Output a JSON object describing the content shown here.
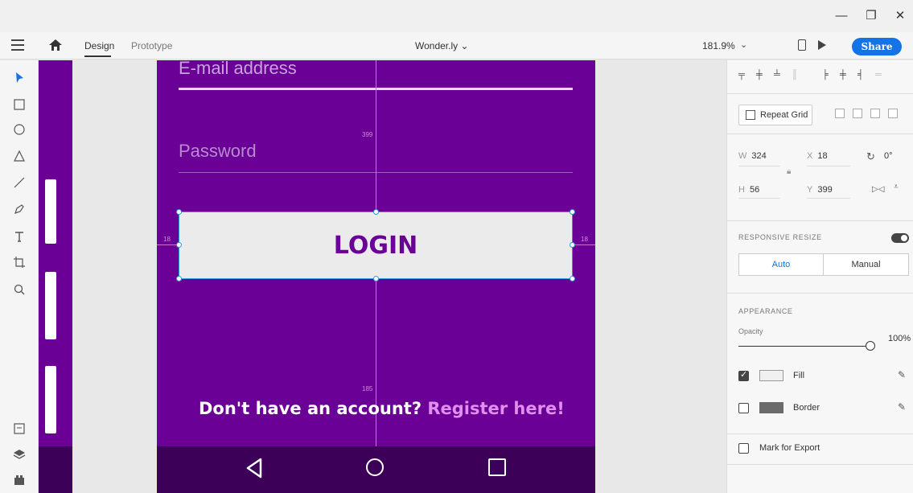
{
  "window": {
    "minimize": "—",
    "restore": "❐",
    "close": "✕"
  },
  "menubar": {
    "tab_design": "Design",
    "tab_prototype": "Prototype",
    "document_title": "Wonder.ly ⌄",
    "zoom": "181.9%",
    "zoom_chevron": "⌄",
    "share_label": "Share",
    "accent_color": "#1473e6"
  },
  "tools": [
    "select-tool",
    "rectangle-tool",
    "ellipse-tool",
    "polygon-tool",
    "line-tool",
    "pen-tool",
    "text-tool",
    "artboard-tool",
    "zoom-tool",
    "assets-panel",
    "layers-panel",
    "plugins-panel"
  ],
  "artboard": {
    "email_placeholder": "E-mail address",
    "password_placeholder": "Password",
    "login_label": "LOGIN",
    "register_text": "Don't have an account? ",
    "register_link": "Register here!",
    "dim_top": "399",
    "dim_left": "18",
    "dim_right": "18",
    "dim_bottom": "185",
    "background_color": "#6a0095"
  },
  "panel": {
    "repeat_grid_label": "Repeat Grid",
    "w_label": "W",
    "w_value": "324",
    "h_label": "H",
    "h_value": "56",
    "x_label": "X",
    "x_value": "18",
    "y_label": "Y",
    "y_value": "399",
    "rotation_value": "0°",
    "responsive_label": "RESPONSIVE RESIZE",
    "resize_auto": "Auto",
    "resize_manual": "Manual",
    "appearance_label": "APPEARANCE",
    "opacity_label": "Opacity",
    "opacity_value": "100%",
    "fill_label": "Fill",
    "border_label": "Border",
    "export_label": "Mark for Export"
  }
}
